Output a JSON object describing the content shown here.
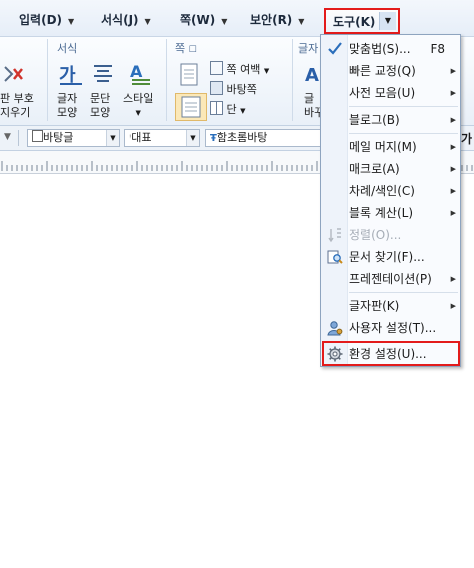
{
  "menubar": {
    "items": [
      {
        "label": "입력(D)"
      },
      {
        "label": "서식(J)"
      },
      {
        "label": "쪽(W)"
      },
      {
        "label": "보안(R)"
      }
    ],
    "tools": {
      "label": "도구(K)"
    }
  },
  "ribbon": {
    "groups": {
      "format": "서식",
      "page": "쪽",
      "char": "글자"
    },
    "buttons": {
      "remove_marks": [
        "판 부호",
        "지우기"
      ],
      "char_shape": [
        "글자",
        "모양"
      ],
      "para_shape": [
        "문단",
        "모양"
      ],
      "style": "스타일",
      "page_margin": "쪽 여백",
      "background": "바탕쪽",
      "column": "단",
      "char_partial": [
        "글",
        "바꾸"
      ]
    }
  },
  "formatbar": {
    "style_combo": "바탕글",
    "lang_combo": "대표",
    "font_combo": "함초롬바탕",
    "right_partial": "가"
  },
  "tools_menu": {
    "items": [
      {
        "label": "맞춤법(S)...",
        "shortcut": "F8",
        "submenu": false,
        "icon": "spellcheck-icon",
        "disabled": false
      },
      {
        "label": "빠른 교정(Q)",
        "submenu": true,
        "disabled": false
      },
      {
        "label": "사전 모음(U)",
        "submenu": true,
        "disabled": false
      },
      {
        "label": "블로그(B)",
        "submenu": true,
        "disabled": false
      },
      {
        "label": "메일 머지(M)",
        "submenu": true,
        "disabled": false
      },
      {
        "label": "매크로(A)",
        "submenu": true,
        "disabled": false
      },
      {
        "label": "차례/색인(C)",
        "submenu": true,
        "disabled": false
      },
      {
        "label": "블록 계산(L)",
        "submenu": true,
        "disabled": false
      },
      {
        "label": "정렬(O)...",
        "submenu": false,
        "icon": "sort-icon",
        "disabled": true
      },
      {
        "label": "문서 찾기(F)...",
        "submenu": false,
        "icon": "document-search-icon",
        "disabled": false
      },
      {
        "label": "프레젠테이션(P)",
        "submenu": true,
        "disabled": false
      },
      {
        "label": "글자판(K)",
        "submenu": true,
        "disabled": false
      },
      {
        "label": "사용자 설정(T)...",
        "submenu": false,
        "icon": "user-settings-icon",
        "disabled": false
      },
      {
        "label": "환경 설정(U)...",
        "submenu": false,
        "icon": "gear-icon",
        "disabled": false
      }
    ]
  },
  "colors": {
    "highlight": "#e31b1b",
    "accent": "#2a6ebb"
  }
}
